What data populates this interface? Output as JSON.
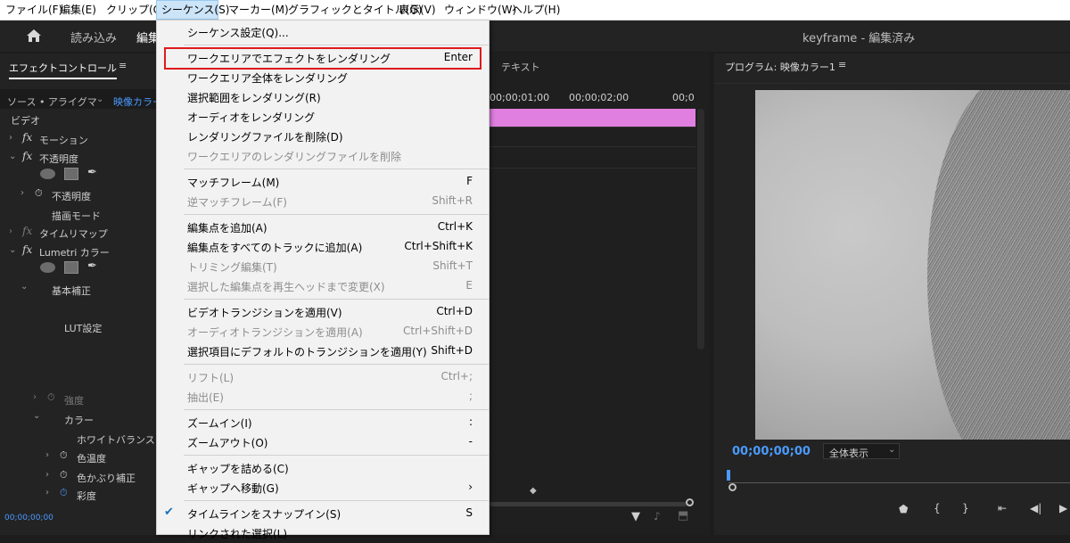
{
  "menubar": {
    "items": [
      "ファイル(F)",
      "編集(E)",
      "クリップ(C)",
      "シーケンス(S)",
      "マーカー(M)",
      "グラフィックとタイトル(G)",
      "表示(V)",
      "ウィンドウ(W)",
      "ヘルプ(H)"
    ]
  },
  "header": {
    "import_tab": "読み込み",
    "edit_tab": "編集",
    "project_title": "keyframe",
    "project_status": " - 編集済み"
  },
  "effect_controls": {
    "panel_title": "エフェクトコントロール",
    "source_label": "ソース • アライグマ",
    "sequence_label": "映像カラー",
    "section_video": "ビデオ",
    "motion": "モーション",
    "opacity": "不透明度",
    "opacity_param": "不透明度",
    "blend_mode": "描画モード",
    "time_remap": "タイムリマップ",
    "lumetri": "Lumetri カラー",
    "basic_correction": "基本補正",
    "lut_setting": "LUT設定",
    "intensity": "強度",
    "color": "カラー",
    "white_balance": "ホワイトバランス",
    "temperature": "色温度",
    "tint": "色かぶり補正",
    "saturation": "彩度",
    "timecode": "00;00;00;00"
  },
  "timeline": {
    "text_tab": "テキスト",
    "ruler": [
      "00;00;01;00",
      "00;00;02;00",
      "00;0"
    ],
    "clip_color": "#e07fe0"
  },
  "program": {
    "title": "プログラム: 映像カラー1",
    "timecode": "00;00;00;00",
    "zoom": "全体表示"
  },
  "sequence_menu": {
    "items": [
      {
        "label": "シーケンス設定(Q)...",
        "shortcut": "",
        "disabled": false
      },
      {
        "label": "ワークエリアでエフェクトをレンダリング",
        "shortcut": "Enter",
        "disabled": false,
        "highlighted": true
      },
      {
        "label": "ワークエリア全体をレンダリング",
        "shortcut": "",
        "disabled": false
      },
      {
        "label": "選択範囲をレンダリング(R)",
        "shortcut": "",
        "disabled": false
      },
      {
        "label": "オーディオをレンダリング",
        "shortcut": "",
        "disabled": false
      },
      {
        "label": "レンダリングファイルを削除(D)",
        "shortcut": "",
        "disabled": false
      },
      {
        "label": "ワークエリアのレンダリングファイルを削除",
        "shortcut": "",
        "disabled": true
      },
      {
        "label": "マッチフレーム(M)",
        "shortcut": "F",
        "disabled": false
      },
      {
        "label": "逆マッチフレーム(F)",
        "shortcut": "Shift+R",
        "disabled": true
      },
      {
        "label": "編集点を追加(A)",
        "shortcut": "Ctrl+K",
        "disabled": false
      },
      {
        "label": "編集点をすべてのトラックに追加(A)",
        "shortcut": "Ctrl+Shift+K",
        "disabled": false
      },
      {
        "label": "トリミング編集(T)",
        "shortcut": "Shift+T",
        "disabled": true
      },
      {
        "label": "選択した編集点を再生ヘッドまで変更(X)",
        "shortcut": "E",
        "disabled": true
      },
      {
        "label": "ビデオトランジションを適用(V)",
        "shortcut": "Ctrl+D",
        "disabled": false
      },
      {
        "label": "オーディオトランジションを適用(A)",
        "shortcut": "Ctrl+Shift+D",
        "disabled": true
      },
      {
        "label": "選択項目にデフォルトのトランジションを適用(Y)",
        "shortcut": "Shift+D",
        "disabled": false
      },
      {
        "label": "リフト(L)",
        "shortcut": "Ctrl+;",
        "disabled": true
      },
      {
        "label": "抽出(E)",
        "shortcut": ";",
        "disabled": true
      },
      {
        "label": "ズームイン(I)",
        "shortcut": ":",
        "disabled": false
      },
      {
        "label": "ズームアウト(O)",
        "shortcut": "-",
        "disabled": false
      },
      {
        "label": "ギャップを詰める(C)",
        "shortcut": "",
        "disabled": false
      },
      {
        "label": "ギャップへ移動(G)",
        "shortcut": "›",
        "disabled": false
      },
      {
        "label": "タイムラインをスナップイン(S)",
        "shortcut": "S",
        "disabled": false,
        "checked": true
      },
      {
        "label": "リンクされた選択(L)",
        "shortcut": "",
        "disabled": false
      }
    ]
  },
  "colors": {
    "accent_blue": "#4a9bff",
    "highlight_red": "#e0191b"
  }
}
